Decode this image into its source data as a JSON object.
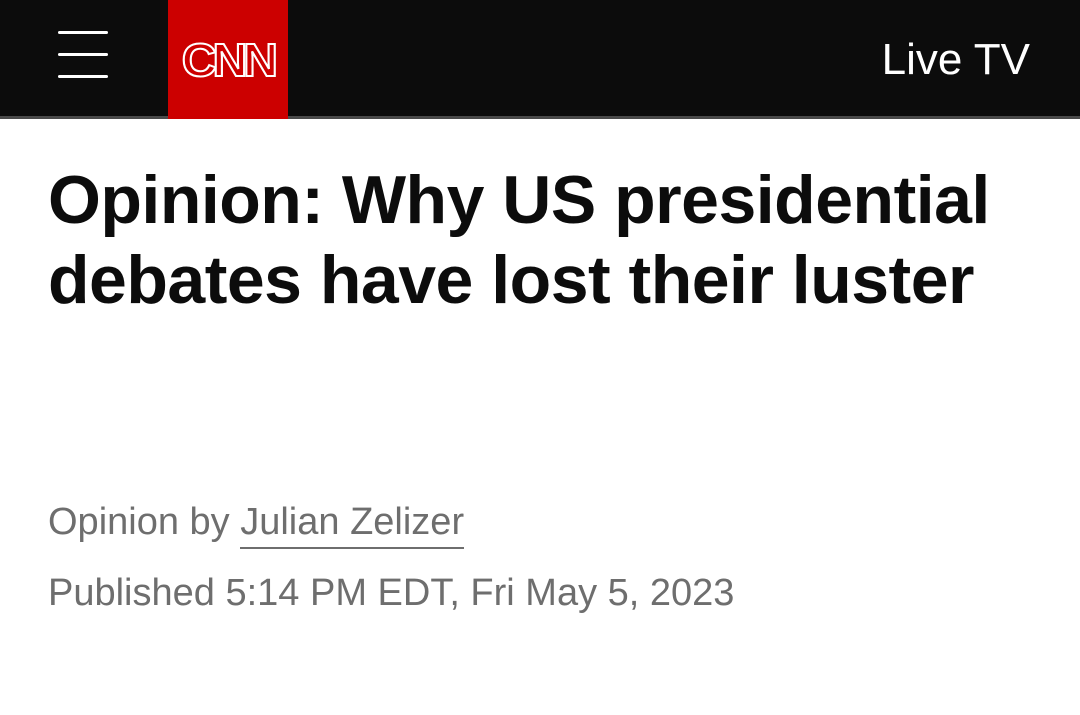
{
  "header": {
    "logo_text": "CNN",
    "live_tv_label": "Live TV",
    "menu_icon": "hamburger-menu-icon",
    "colors": {
      "bar_background": "#0c0c0c",
      "logo_background": "#cc0000"
    }
  },
  "article": {
    "headline": "Opinion: Why US presidential debates have lost their luster",
    "byline_prefix": "Opinion by",
    "author": "Julian Zelizer",
    "published": "Published 5:14 PM EDT, Fri May 5, 2023"
  }
}
